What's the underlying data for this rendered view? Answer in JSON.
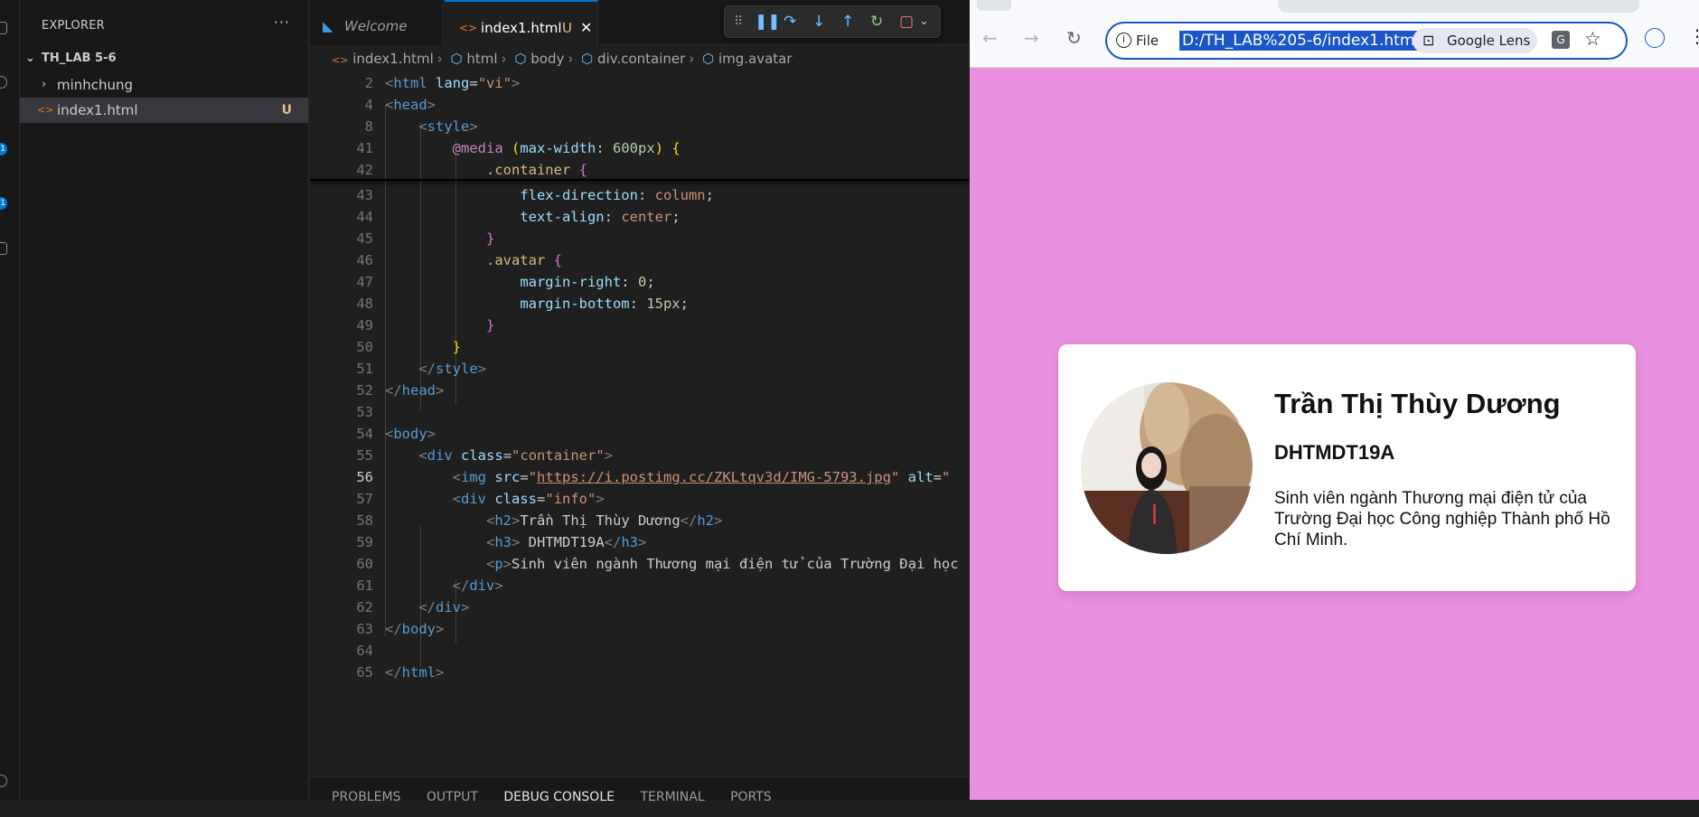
{
  "explorer": {
    "title": "EXPLORER",
    "project": "TH_LAB 5-6",
    "items": [
      {
        "label": "minhchung"
      },
      {
        "label": "index1.html",
        "status": "U"
      }
    ]
  },
  "editor": {
    "tabs": [
      {
        "label": "Welcome"
      },
      {
        "label": "index1.html",
        "status": "U"
      }
    ],
    "breadcrumb": [
      "index1.html",
      "html",
      "body",
      "div.container",
      "img.avatar"
    ],
    "line_numbers": [
      "2",
      "4",
      "8",
      "41",
      "42",
      "43",
      "44",
      "45",
      "46",
      "47",
      "48",
      "49",
      "50",
      "51",
      "52",
      "53",
      "54",
      "55",
      "56",
      "57",
      "58",
      "59",
      "60",
      "61",
      "62",
      "63",
      "64",
      "65"
    ],
    "current_line": "56"
  },
  "panel_tabs": [
    "PROBLEMS",
    "OUTPUT",
    "DEBUG CONSOLE",
    "TERMINAL",
    "PORTS"
  ],
  "browser": {
    "file_label": "File",
    "url": "D:/TH_LAB%205-6/index1.html",
    "lens_label": "Google Lens"
  },
  "profile": {
    "name": "Trần Thị Thùy Dương",
    "class": "DHTMDT19A",
    "description": "Sinh viên ngành Thương mại điện tử của Trường Đại học Công nghiệp Thành phố Hồ Chí Minh."
  },
  "colors": {
    "page_background": "#ea90e0",
    "accent": "#0078d4",
    "untracked": "#e2c08d"
  },
  "icons": [
    "explorer-icon",
    "chevron-right-icon",
    "html-file-icon",
    "vscode-icon",
    "close-icon",
    "pause-icon",
    "step-over-icon",
    "step-into-icon",
    "step-out-icon",
    "restart-icon",
    "stop-icon",
    "back-icon",
    "forward-icon",
    "reload-icon",
    "info-icon",
    "lens-icon",
    "translate-icon",
    "star-icon",
    "profile-icon"
  ]
}
